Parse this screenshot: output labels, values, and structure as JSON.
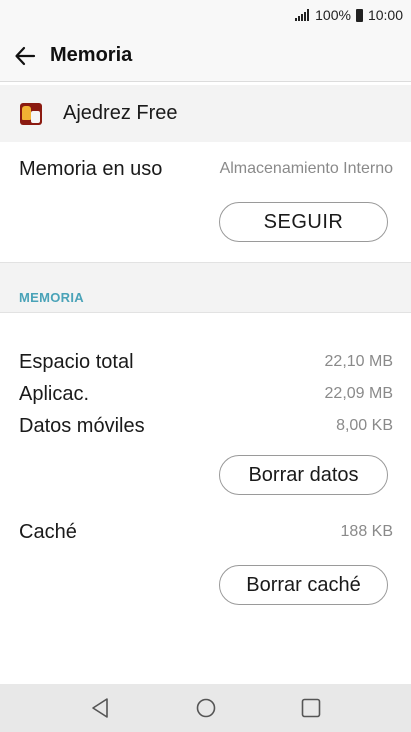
{
  "status": {
    "signal_icon": "signal-bars-icon",
    "battery_percent": "100%",
    "battery_icon": "battery-icon",
    "time": "10:00"
  },
  "app_bar": {
    "back_icon": "arrow-left-icon",
    "title": "Memoria"
  },
  "app": {
    "icon": "chess-app-icon",
    "name": "Ajedrez Free"
  },
  "storage": {
    "label": "Memoria en uso",
    "value": "Almacenamiento Interno",
    "button": "SEGUIR"
  },
  "section": {
    "title": "MEMORIA",
    "accent_color": "#4aa3b8"
  },
  "stats": [
    {
      "label": "Espacio total",
      "value": "22,10 MB"
    },
    {
      "label": "Aplicac.",
      "value": "22,09 MB"
    },
    {
      "label": "Datos móviles",
      "value": "8,00 KB"
    }
  ],
  "clear_data_button": "Borrar datos",
  "cache": {
    "label": "Caché",
    "value": "188 KB",
    "button": "Borrar caché"
  },
  "nav": {
    "back_icon": "triangle-back-icon",
    "home_icon": "circle-home-icon",
    "recent_icon": "square-recents-icon"
  }
}
